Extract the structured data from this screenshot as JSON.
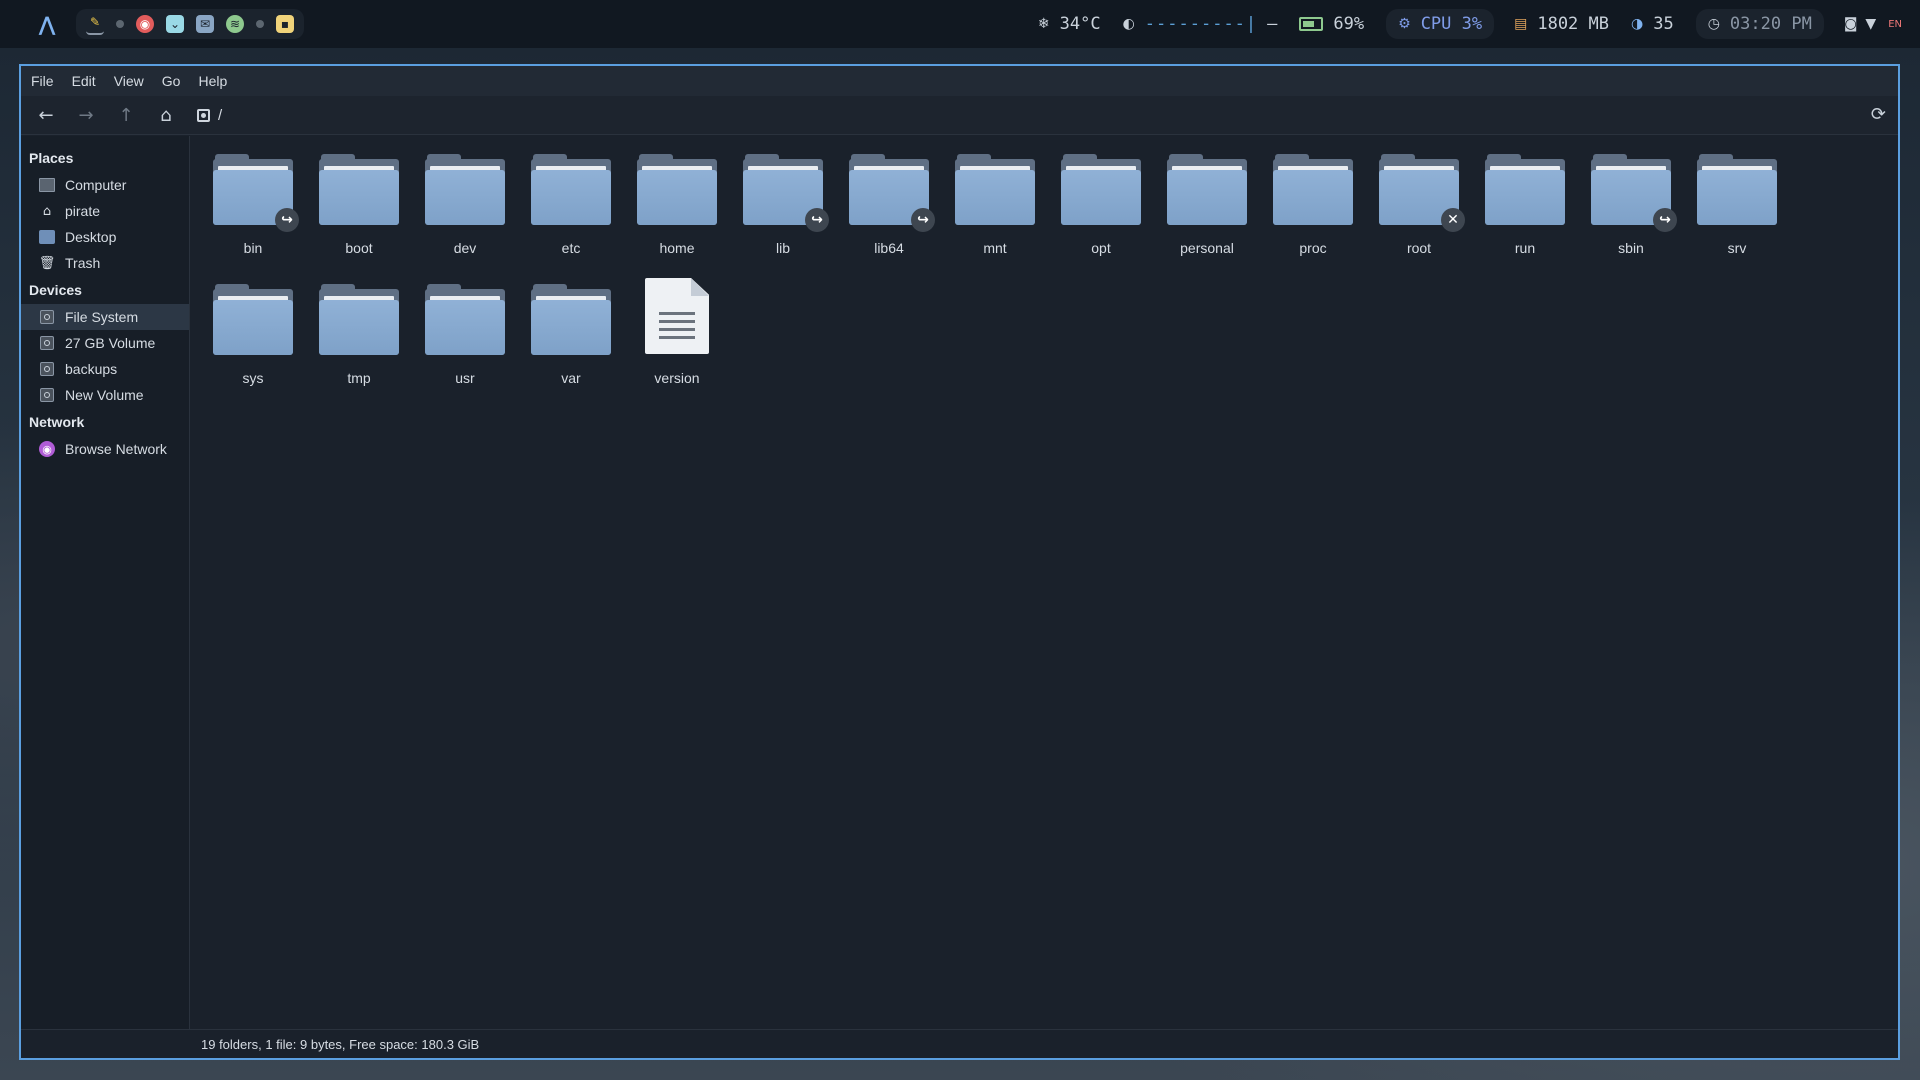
{
  "topbar": {
    "temperature": "34°C",
    "volume_bar": "---------|",
    "volume_dash": "–",
    "battery": "69%",
    "cpu": "CPU 3%",
    "memory": "1802 MB",
    "brightness": "35",
    "clock": "03:20 PM",
    "locale": "EN",
    "tray_icons": [
      "pen-icon",
      "dot",
      "chrome-icon",
      "pocket-icon",
      "mail-icon",
      "spotify-icon",
      "dot",
      "chat-icon"
    ]
  },
  "menu": {
    "file": "File",
    "edit": "Edit",
    "view": "View",
    "go": "Go",
    "help": "Help"
  },
  "location": {
    "path": "/"
  },
  "sidebar": {
    "places_header": "Places",
    "places": [
      {
        "label": "Computer",
        "icon": "computer-icon"
      },
      {
        "label": "pirate",
        "icon": "home-icon"
      },
      {
        "label": "Desktop",
        "icon": "desktop-icon"
      },
      {
        "label": "Trash",
        "icon": "trash-icon"
      }
    ],
    "devices_header": "Devices",
    "devices": [
      {
        "label": "File System",
        "icon": "drive-icon",
        "active": true
      },
      {
        "label": "27 GB Volume",
        "icon": "drive-icon"
      },
      {
        "label": "backups",
        "icon": "drive-icon"
      },
      {
        "label": "New Volume",
        "icon": "drive-icon"
      }
    ],
    "network_header": "Network",
    "network": [
      {
        "label": "Browse Network",
        "icon": "network-icon"
      }
    ]
  },
  "files": [
    {
      "name": "bin",
      "type": "folder",
      "emblem": "link"
    },
    {
      "name": "boot",
      "type": "folder"
    },
    {
      "name": "dev",
      "type": "folder"
    },
    {
      "name": "etc",
      "type": "folder"
    },
    {
      "name": "home",
      "type": "folder"
    },
    {
      "name": "lib",
      "type": "folder",
      "emblem": "link"
    },
    {
      "name": "lib64",
      "type": "folder",
      "emblem": "link"
    },
    {
      "name": "mnt",
      "type": "folder"
    },
    {
      "name": "opt",
      "type": "folder"
    },
    {
      "name": "personal",
      "type": "folder"
    },
    {
      "name": "proc",
      "type": "folder"
    },
    {
      "name": "root",
      "type": "folder",
      "emblem": "locked"
    },
    {
      "name": "run",
      "type": "folder"
    },
    {
      "name": "sbin",
      "type": "folder",
      "emblem": "link"
    },
    {
      "name": "srv",
      "type": "folder"
    },
    {
      "name": "sys",
      "type": "folder"
    },
    {
      "name": "tmp",
      "type": "folder"
    },
    {
      "name": "usr",
      "type": "folder"
    },
    {
      "name": "var",
      "type": "folder"
    },
    {
      "name": "version",
      "type": "file"
    }
  ],
  "status": "19 folders, 1 file: 9 bytes, Free space: 180.3 GiB",
  "colors": {
    "accent": "#5b9fe0",
    "folder_front": "#90b1d6",
    "window_bg": "#1a212b"
  }
}
